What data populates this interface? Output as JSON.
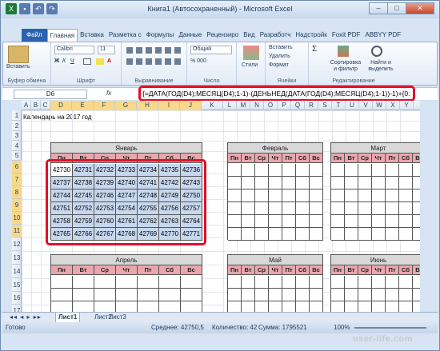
{
  "window": {
    "title": "Книга1 (Автосохраненный) - Microsoft Excel"
  },
  "ribbon_tabs": [
    "Файл",
    "Главная",
    "Вставка",
    "Разметка с",
    "Формулы",
    "Данные",
    "Рецензиро",
    "Вид",
    "Разработч",
    "Надстройк",
    "Foxit PDF",
    "ABBYY PDF"
  ],
  "ribbon": {
    "paste": "Вставить",
    "clipboard": "Буфер обмена",
    "font_name": "Calibri",
    "font_size": "11",
    "font_group": "Шрифт",
    "align_group": "Выравнивание",
    "number_format": "Общий",
    "number_group": "Число",
    "styles": "Стили",
    "insert": "Вставить",
    "delete": "Удалить",
    "format": "Формат",
    "cells_group": "Ячейки",
    "sort": "Сортировка\nи фильтр",
    "find": "Найти и\nвыделить",
    "edit_group": "Редактирование"
  },
  "formula_bar": {
    "name_box": "D6",
    "fx": "fx",
    "formula": "{=ДАТА(ГОД(D4);МЕСЯЦ(D4);1-1)-(ДЕНЬНЕД(ДАТА(ГОД(D4);МЕСЯЦ(D4);1-1))-1)+{0:"
  },
  "columns": [
    "A",
    "B",
    "C",
    "D",
    "E",
    "F",
    "G",
    "H",
    "I",
    "J",
    "K",
    "L",
    "M",
    "N",
    "O",
    "P",
    "Q",
    "R",
    "S",
    "T",
    "U",
    "V",
    "W",
    "X",
    "Y"
  ],
  "rows": [
    "1",
    "2",
    "3",
    "4",
    "5",
    "6",
    "7",
    "8",
    "9",
    "10",
    "11",
    "12",
    "13",
    "14",
    "15",
    "16",
    "17"
  ],
  "title_cell": "Календарь на 2017 год",
  "weekdays": [
    "Пн",
    "Вт",
    "Ср",
    "Чт",
    "Пт",
    "Сб",
    "Вс"
  ],
  "months": [
    "Январь",
    "Февраль",
    "Март",
    "Апрель",
    "Май",
    "Июнь"
  ],
  "january_values": [
    [
      "42730",
      "42731",
      "42732",
      "42733",
      "42734",
      "42735",
      "42736"
    ],
    [
      "42737",
      "42738",
      "42739",
      "42740",
      "42741",
      "42742",
      "42743"
    ],
    [
      "42744",
      "42745",
      "42746",
      "42747",
      "42748",
      "42749",
      "42750"
    ],
    [
      "42751",
      "42752",
      "42753",
      "42754",
      "42755",
      "42756",
      "42757"
    ],
    [
      "42758",
      "42759",
      "42760",
      "42761",
      "42762",
      "42763",
      "42764"
    ],
    [
      "42765",
      "42766",
      "42767",
      "42768",
      "42769",
      "42770",
      "42771"
    ]
  ],
  "sheets": [
    "Лист1",
    "Лист2",
    "Лист3"
  ],
  "status": {
    "mode": "Готово",
    "average": "Среднее: 42750,5",
    "count": "Количество: 42",
    "sum": "Сумма: 1795521",
    "zoom": "100%"
  },
  "watermark": "user-life.com"
}
